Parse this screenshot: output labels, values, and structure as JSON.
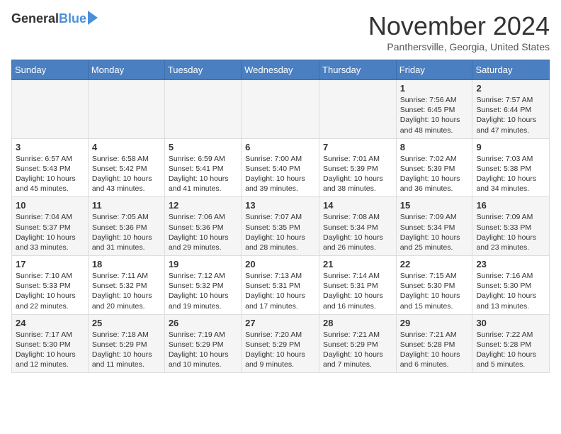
{
  "header": {
    "logo_general": "General",
    "logo_blue": "Blue",
    "month": "November 2024",
    "location": "Panthersville, Georgia, United States"
  },
  "days_of_week": [
    "Sunday",
    "Monday",
    "Tuesday",
    "Wednesday",
    "Thursday",
    "Friday",
    "Saturday"
  ],
  "weeks": [
    [
      {
        "day": "",
        "content": ""
      },
      {
        "day": "",
        "content": ""
      },
      {
        "day": "",
        "content": ""
      },
      {
        "day": "",
        "content": ""
      },
      {
        "day": "",
        "content": ""
      },
      {
        "day": "1",
        "content": "Sunrise: 7:56 AM\nSunset: 6:45 PM\nDaylight: 10 hours and 48 minutes."
      },
      {
        "day": "2",
        "content": "Sunrise: 7:57 AM\nSunset: 6:44 PM\nDaylight: 10 hours and 47 minutes."
      }
    ],
    [
      {
        "day": "3",
        "content": "Sunrise: 6:57 AM\nSunset: 5:43 PM\nDaylight: 10 hours and 45 minutes."
      },
      {
        "day": "4",
        "content": "Sunrise: 6:58 AM\nSunset: 5:42 PM\nDaylight: 10 hours and 43 minutes."
      },
      {
        "day": "5",
        "content": "Sunrise: 6:59 AM\nSunset: 5:41 PM\nDaylight: 10 hours and 41 minutes."
      },
      {
        "day": "6",
        "content": "Sunrise: 7:00 AM\nSunset: 5:40 PM\nDaylight: 10 hours and 39 minutes."
      },
      {
        "day": "7",
        "content": "Sunrise: 7:01 AM\nSunset: 5:39 PM\nDaylight: 10 hours and 38 minutes."
      },
      {
        "day": "8",
        "content": "Sunrise: 7:02 AM\nSunset: 5:39 PM\nDaylight: 10 hours and 36 minutes."
      },
      {
        "day": "9",
        "content": "Sunrise: 7:03 AM\nSunset: 5:38 PM\nDaylight: 10 hours and 34 minutes."
      }
    ],
    [
      {
        "day": "10",
        "content": "Sunrise: 7:04 AM\nSunset: 5:37 PM\nDaylight: 10 hours and 33 minutes."
      },
      {
        "day": "11",
        "content": "Sunrise: 7:05 AM\nSunset: 5:36 PM\nDaylight: 10 hours and 31 minutes."
      },
      {
        "day": "12",
        "content": "Sunrise: 7:06 AM\nSunset: 5:36 PM\nDaylight: 10 hours and 29 minutes."
      },
      {
        "day": "13",
        "content": "Sunrise: 7:07 AM\nSunset: 5:35 PM\nDaylight: 10 hours and 28 minutes."
      },
      {
        "day": "14",
        "content": "Sunrise: 7:08 AM\nSunset: 5:34 PM\nDaylight: 10 hours and 26 minutes."
      },
      {
        "day": "15",
        "content": "Sunrise: 7:09 AM\nSunset: 5:34 PM\nDaylight: 10 hours and 25 minutes."
      },
      {
        "day": "16",
        "content": "Sunrise: 7:09 AM\nSunset: 5:33 PM\nDaylight: 10 hours and 23 minutes."
      }
    ],
    [
      {
        "day": "17",
        "content": "Sunrise: 7:10 AM\nSunset: 5:33 PM\nDaylight: 10 hours and 22 minutes."
      },
      {
        "day": "18",
        "content": "Sunrise: 7:11 AM\nSunset: 5:32 PM\nDaylight: 10 hours and 20 minutes."
      },
      {
        "day": "19",
        "content": "Sunrise: 7:12 AM\nSunset: 5:32 PM\nDaylight: 10 hours and 19 minutes."
      },
      {
        "day": "20",
        "content": "Sunrise: 7:13 AM\nSunset: 5:31 PM\nDaylight: 10 hours and 17 minutes."
      },
      {
        "day": "21",
        "content": "Sunrise: 7:14 AM\nSunset: 5:31 PM\nDaylight: 10 hours and 16 minutes."
      },
      {
        "day": "22",
        "content": "Sunrise: 7:15 AM\nSunset: 5:30 PM\nDaylight: 10 hours and 15 minutes."
      },
      {
        "day": "23",
        "content": "Sunrise: 7:16 AM\nSunset: 5:30 PM\nDaylight: 10 hours and 13 minutes."
      }
    ],
    [
      {
        "day": "24",
        "content": "Sunrise: 7:17 AM\nSunset: 5:30 PM\nDaylight: 10 hours and 12 minutes."
      },
      {
        "day": "25",
        "content": "Sunrise: 7:18 AM\nSunset: 5:29 PM\nDaylight: 10 hours and 11 minutes."
      },
      {
        "day": "26",
        "content": "Sunrise: 7:19 AM\nSunset: 5:29 PM\nDaylight: 10 hours and 10 minutes."
      },
      {
        "day": "27",
        "content": "Sunrise: 7:20 AM\nSunset: 5:29 PM\nDaylight: 10 hours and 9 minutes."
      },
      {
        "day": "28",
        "content": "Sunrise: 7:21 AM\nSunset: 5:29 PM\nDaylight: 10 hours and 7 minutes."
      },
      {
        "day": "29",
        "content": "Sunrise: 7:21 AM\nSunset: 5:28 PM\nDaylight: 10 hours and 6 minutes."
      },
      {
        "day": "30",
        "content": "Sunrise: 7:22 AM\nSunset: 5:28 PM\nDaylight: 10 hours and 5 minutes."
      }
    ]
  ]
}
